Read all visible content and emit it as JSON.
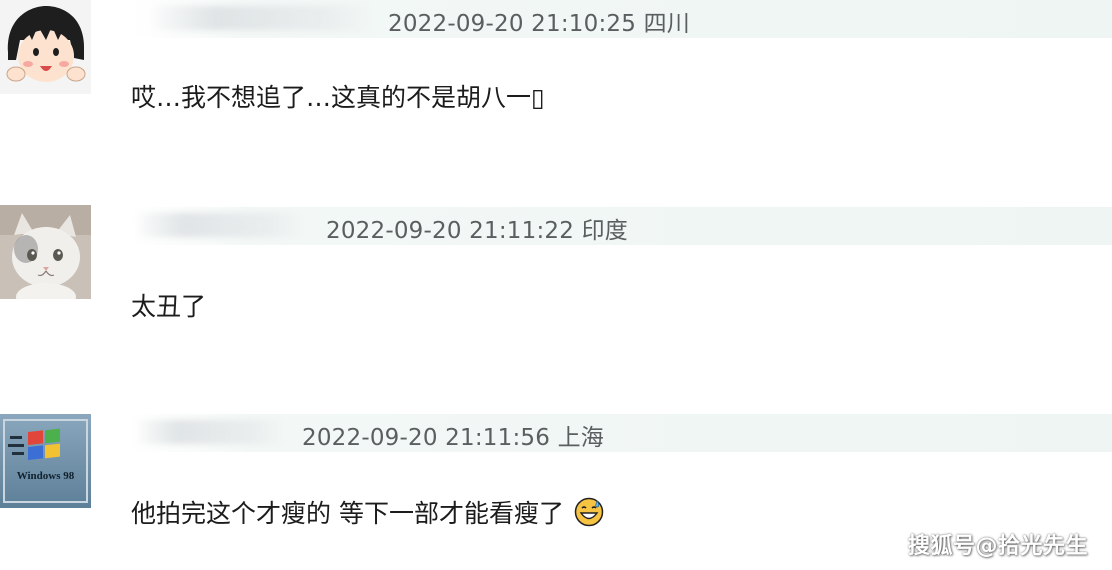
{
  "comments": [
    {
      "avatar_icon": "cartoon-girl-avatar-icon",
      "timestamp": "2022-09-20 21:10:25",
      "location": "四川",
      "text": "哎…我不想追了…这真的不是胡八一▯"
    },
    {
      "avatar_icon": "cat-avatar-icon",
      "timestamp": "2022-09-20 21:11:22",
      "location": "印度",
      "text": "太丑了"
    },
    {
      "avatar_icon": "windows-logo-avatar-icon",
      "avatar_caption": "Windows 98",
      "timestamp": "2022-09-20 21:11:56",
      "location": "上海",
      "text": "他拍完这个才瘦的 等下一部才能看瘦了",
      "emoji": "grinning-sweat-emoji"
    }
  ],
  "watermark": "搜狐号@拾光先生",
  "colors": {
    "meta_bar": "#eef5f3",
    "meta_text": "#5b5e60",
    "comment_text": "#1c1c1c",
    "emoji_yellow": "#f6c343"
  }
}
